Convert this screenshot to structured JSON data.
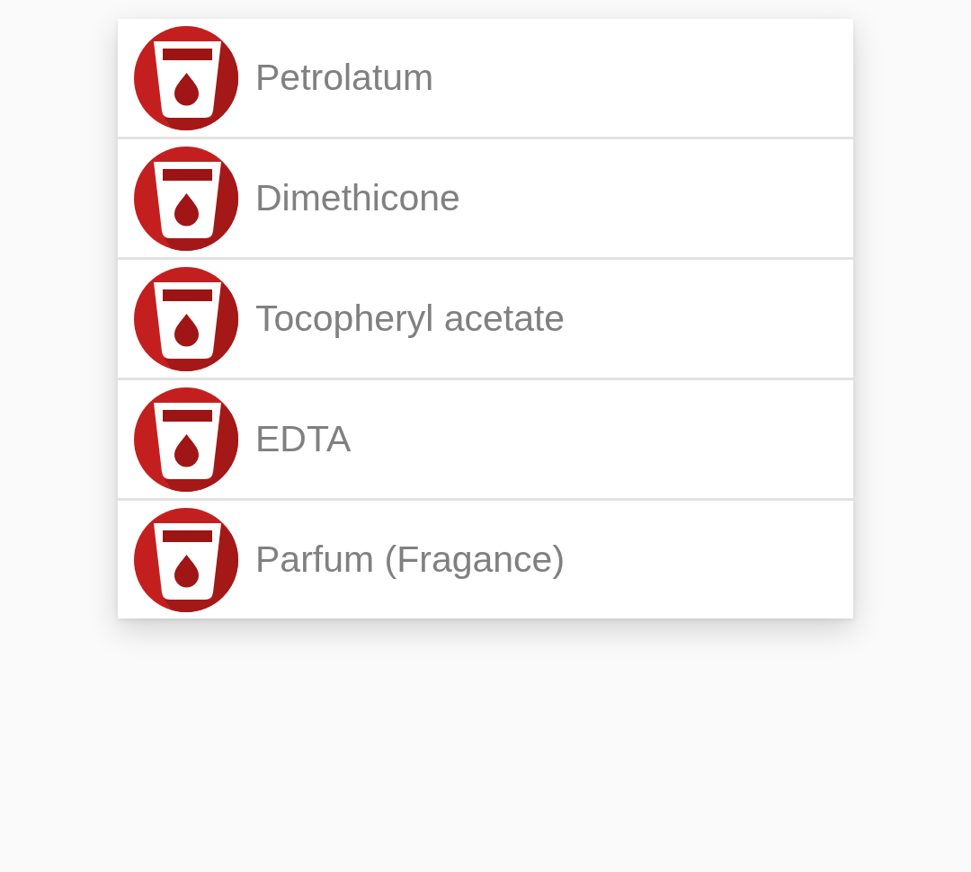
{
  "items": [
    {
      "name": "Petrolatum"
    },
    {
      "name": "Dimethicone"
    },
    {
      "name": "Tocopheryl acetate"
    },
    {
      "name": "EDTA"
    },
    {
      "name": "Parfum (Fragance)"
    }
  ]
}
